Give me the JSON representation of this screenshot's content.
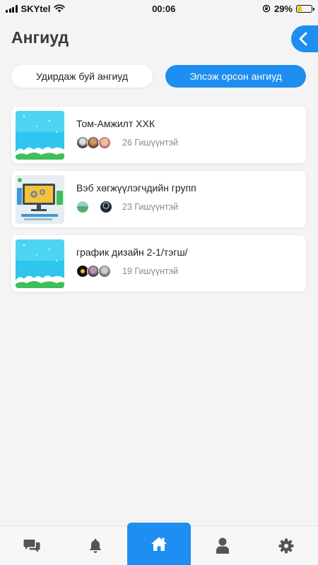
{
  "status_bar": {
    "carrier": "SKYtel",
    "time": "00:06",
    "battery_percent": "29%",
    "battery_level": 0.29
  },
  "header": {
    "title": "Ангиуд",
    "back_icon": "chevron-left-icon"
  },
  "tabs": [
    {
      "label": "Удирдаж буй ангиуд",
      "active": false
    },
    {
      "label": "Элсэж орсон ангиуд",
      "active": true
    }
  ],
  "classes": [
    {
      "name": "Том-Амжилт ХХК",
      "members": "26 Гишүүнтэй",
      "thumbnail": "sky-clouds"
    },
    {
      "name": "Вэб хөгжүүлэгчдийн групп",
      "members": "23 Гишүүнтэй",
      "thumbnail": "web-dev-illustration"
    },
    {
      "name": "график дизайн 2-1/тэгш/",
      "members": "19 Гишүүнтэй",
      "thumbnail": "sky-clouds"
    }
  ],
  "bottom_nav": [
    {
      "icon": "chat-icon",
      "active": false
    },
    {
      "icon": "bell-icon",
      "active": false
    },
    {
      "icon": "home-icon",
      "active": true
    },
    {
      "icon": "user-icon",
      "active": false
    },
    {
      "icon": "gear-icon",
      "active": false
    }
  ],
  "colors": {
    "accent": "#1e8ef0",
    "background": "#f4f4f5",
    "nav_icon": "#555555"
  }
}
